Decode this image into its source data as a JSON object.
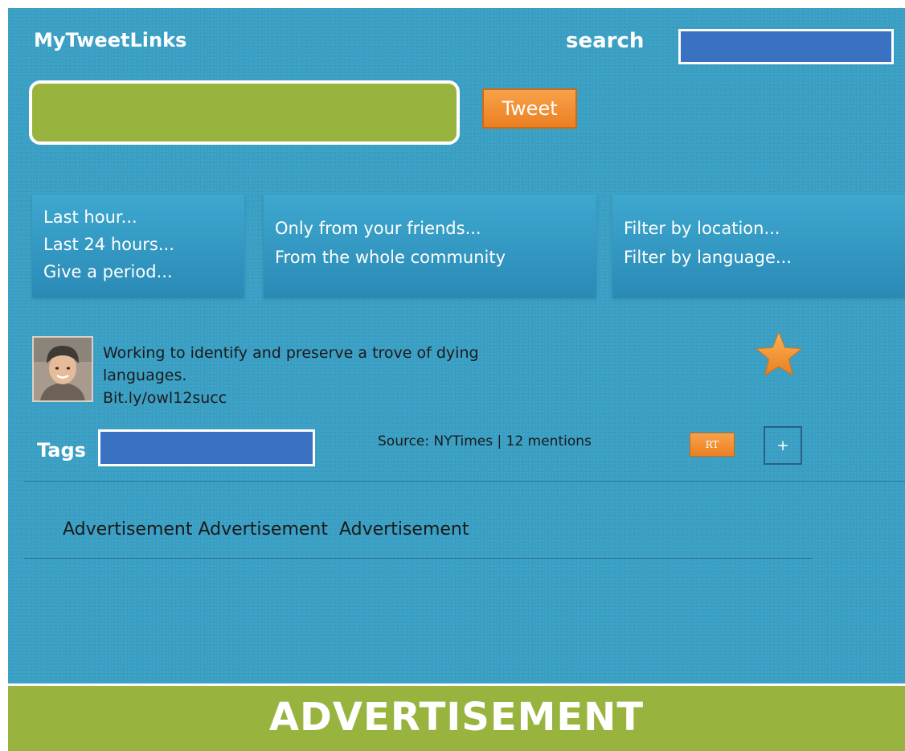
{
  "header": {
    "app_title": "MyTweetLinks",
    "search_label": "search",
    "search_value": ""
  },
  "compose": {
    "tweet_value": "",
    "tweet_button_label": "Tweet"
  },
  "filters": {
    "time": [
      "Last hour...",
      "Last 24 hours...",
      "Give a period..."
    ],
    "scope": [
      "Only from your friends...",
      "From the whole community"
    ],
    "other": [
      "Filter by location...",
      "Filter by language..."
    ]
  },
  "tweet": {
    "text_line1": "Working to identify and preserve a trove of dying",
    "text_line2": "languages.",
    "link": "Bit.ly/owl12succ",
    "tags_label": "Tags",
    "tags_value": "",
    "source": "Source: NYTimes | 12 mentions",
    "rt_label": "RT",
    "plus_label": "+",
    "favorite_icon": "star-icon"
  },
  "ads": {
    "inline_text": "Advertisement Advertisement  Advertisement",
    "banner_text": "ADVERTISEMENT"
  },
  "colors": {
    "background": "#3a9fc4",
    "input_blue": "#3a71c0",
    "green": "#98b43f",
    "orange": "#ec7f22"
  }
}
